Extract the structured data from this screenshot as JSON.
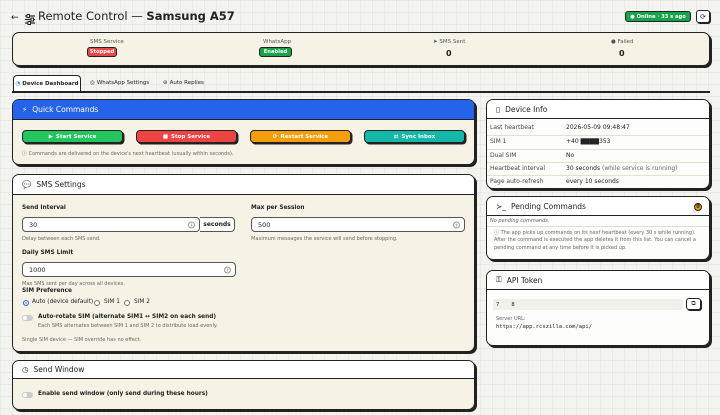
{
  "header": {
    "back_icon": "arrow-left-icon",
    "sliders_icon": "sliders-icon",
    "title_prefix": "Remote Control — ",
    "title_device": "Samsung A57",
    "status_badge": "Online · 33 s ago",
    "refresh_icon": "refresh-icon"
  },
  "summary": {
    "sms_service_label": "SMS Service",
    "sms_service_status": "Stopped",
    "whatsapp_label": "WhatsApp",
    "whatsapp_status": "Enabled",
    "sms_sent_label": "SMS Sent",
    "sms_sent_value": "0",
    "failed_label": "Failed",
    "failed_value": "0"
  },
  "tabs": [
    {
      "label": "Device Dashboard",
      "active": true
    },
    {
      "label": "WhatsApp Settings",
      "active": false
    },
    {
      "label": "Auto Replies",
      "active": false
    }
  ],
  "quick_commands": {
    "title": "Quick Commands",
    "buttons": [
      {
        "label": "Start Service",
        "color": "#22c55e"
      },
      {
        "label": "Stop Service",
        "color": "#ef4444"
      },
      {
        "label": "Restart Service",
        "color": "#f59e0b"
      },
      {
        "label": "Sync Inbox",
        "color": "#14b8a6"
      }
    ],
    "note": "Commands are delivered on the device's next heartbeat (usually within seconds)."
  },
  "sms_settings": {
    "title": "SMS Settings",
    "send_interval_label": "Send Interval",
    "send_interval_value": "30",
    "send_interval_unit": "seconds",
    "send_interval_help": "Delay between each SMS send.",
    "max_per_session_label": "Max per Session",
    "max_per_session_value": "500",
    "max_per_session_help": "Maximum messages the service will send before stopping.",
    "daily_limit_label": "Daily SMS Limit",
    "daily_limit_value": "1000",
    "daily_limit_help": "Max SMS sent per day across all devices.",
    "sim_pref_label": "SIM Preference",
    "sim_options": [
      "Auto (device default)",
      "SIM 1",
      "SIM 2"
    ],
    "auto_rotate_label": "Auto-rotate SIM (alternate SIM1 ↔ SIM2 on each send)",
    "auto_rotate_help": "Each SMS alternates between SIM 1 and SIM 2 to distribute load evenly.",
    "single_sim_note": "Single SIM device — SIM override has no effect."
  },
  "send_window": {
    "title": "Send Window",
    "toggle_label": "Enable send window (only send during these hours)"
  },
  "device_info": {
    "title": "Device Info",
    "rows": [
      {
        "label": "Last heartbeat",
        "value": "2026-05-09 09:48:47",
        "extra": ""
      },
      {
        "label": "SIM 1",
        "value": "+40 ▇▇▇▇353",
        "extra": ""
      },
      {
        "label": "Dual SIM",
        "value": "No",
        "extra": ""
      },
      {
        "label": "Heartbeat interval",
        "value": "30 seconds",
        "extra": " (while service is running)"
      },
      {
        "label": "Page auto-refresh",
        "value": "every 10 seconds",
        "extra": ""
      }
    ]
  },
  "pending": {
    "title": "Pending Commands",
    "badge": "0",
    "empty": "No pending commands.",
    "note": "The app picks up commands on its next heartbeat (every 30 s while running). After the command is executed the app deletes it from this list. You can cancel a pending command at any time before it is picked up."
  },
  "api_token": {
    "title": "API Token",
    "token_prefix": "7",
    "token_suffix": "8",
    "server_url_label": "Server URL:",
    "server_url": "https://app.rcszilla.com/api/"
  }
}
